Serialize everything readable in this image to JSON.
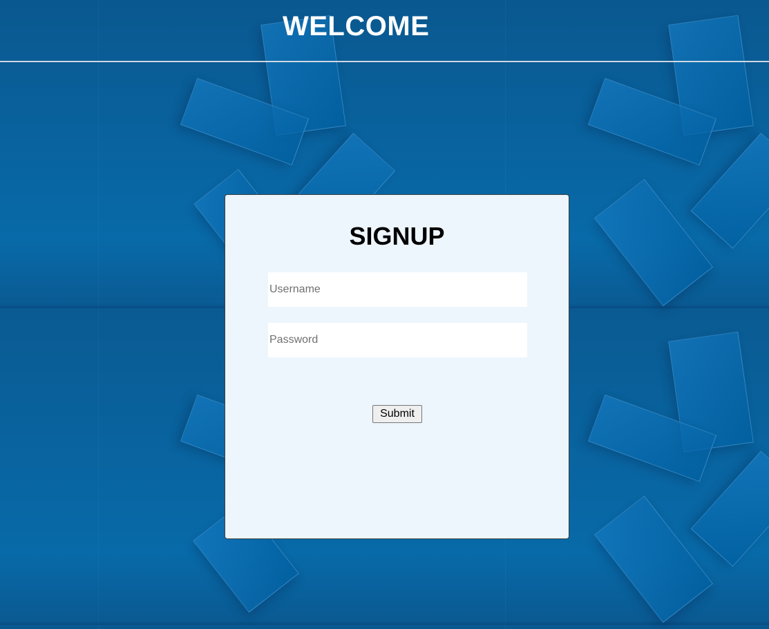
{
  "header": {
    "title": "WELCOME"
  },
  "form": {
    "title": "SIGNUP",
    "username_placeholder": "Username",
    "username_value": "",
    "password_placeholder": "Password",
    "password_value": "",
    "submit_label": "Submit"
  },
  "colors": {
    "background": "#0a5b93",
    "panel": "#eef6fd",
    "header_text": "#ffffff"
  }
}
